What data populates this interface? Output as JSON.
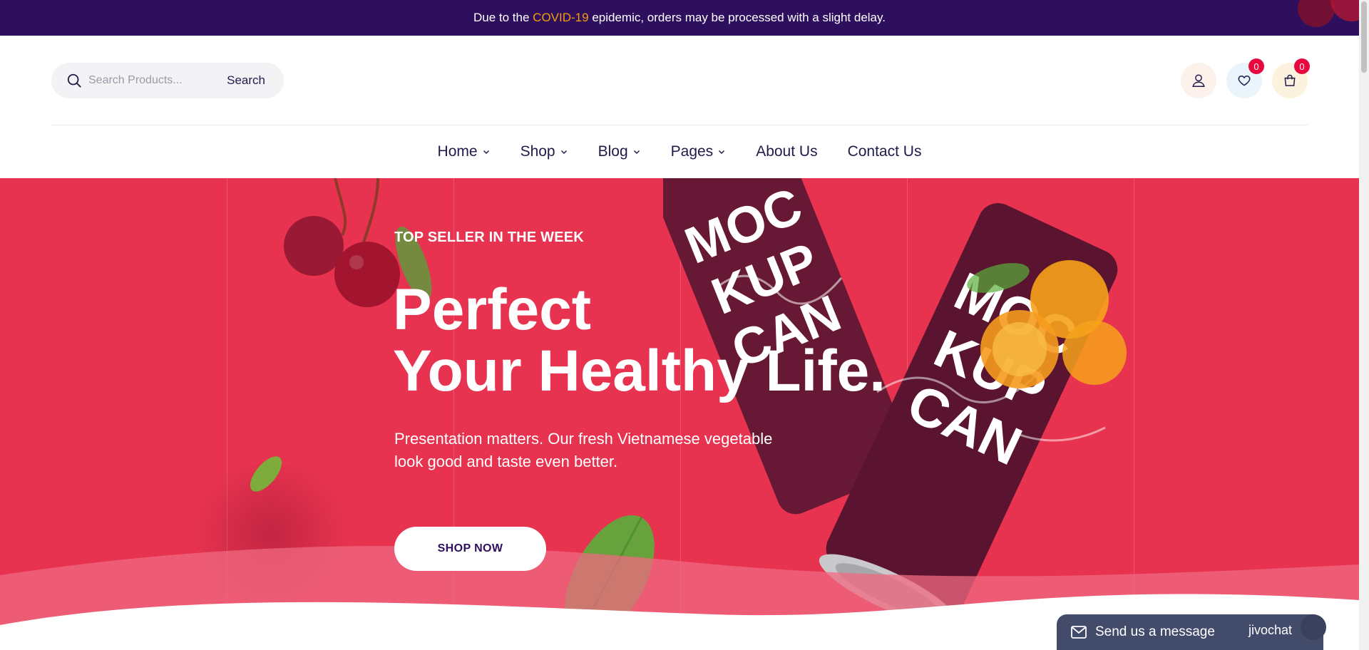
{
  "announcement": {
    "prefix": "Due to the ",
    "highlight": "COVID-19",
    "suffix": " epidemic, orders may be processed with a slight delay.",
    "highlight_color": "#f59e0b",
    "bg_color": "#2e0f5e"
  },
  "search": {
    "placeholder": "Search Products...",
    "value": "",
    "button_label": "Search",
    "icon": "search-icon"
  },
  "header_icons": {
    "account_icon": "user-icon",
    "wishlist_icon": "heart-icon",
    "wishlist_count": "0",
    "cart_icon": "shopping-bag-icon",
    "cart_count": "0",
    "badge_color": "#e8083e"
  },
  "nav": {
    "items": [
      {
        "label": "Home",
        "has_dropdown": true
      },
      {
        "label": "Shop",
        "has_dropdown": true
      },
      {
        "label": "Blog",
        "has_dropdown": true
      },
      {
        "label": "Pages",
        "has_dropdown": true
      },
      {
        "label": "About Us",
        "has_dropdown": false
      },
      {
        "label": "Contact Us",
        "has_dropdown": false
      }
    ]
  },
  "hero": {
    "subtitle": "TOP SELLER IN THE WEEK",
    "title_line1": "Perfect",
    "title_line2": "Your Healthy Life.",
    "description": "Presentation matters. Our fresh Vietnamese vegetable look good and taste even better.",
    "button_label": "SHOP NOW",
    "bg_color": "#e7334f",
    "can_text": "MOC KUP CAN"
  },
  "chat": {
    "label": "Send us a message",
    "brand": "jivochat",
    "icon": "mail-icon"
  }
}
